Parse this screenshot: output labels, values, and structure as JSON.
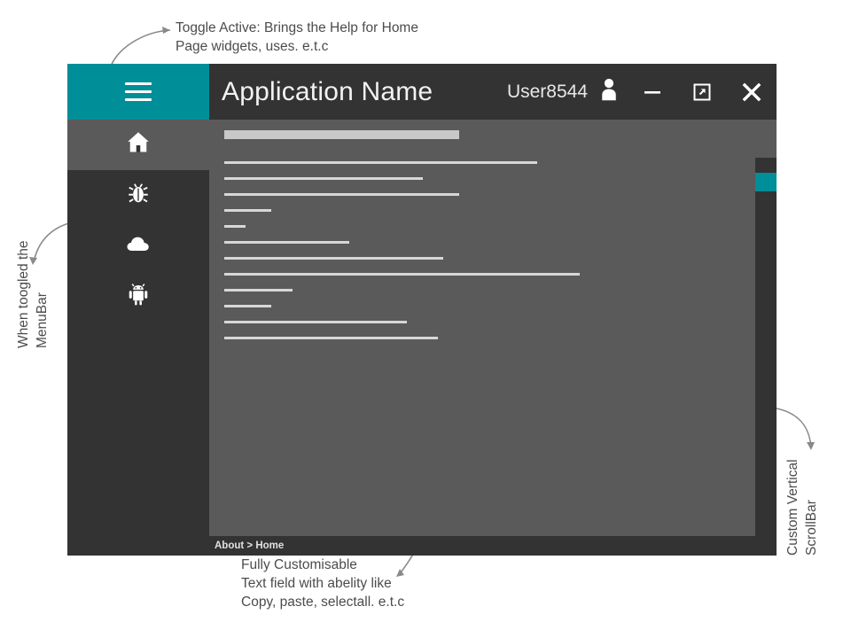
{
  "window": {
    "title": "Application Name",
    "user": "User8544",
    "menu_toggle_icon": "hamburger-icon",
    "user_icon": "person-icon",
    "minimize_label": "minimize-icon",
    "maximize_label": "restore-icon",
    "close_label": "close-icon"
  },
  "sidebar": {
    "items": [
      {
        "icon": "home-icon",
        "name": "home",
        "active": true
      },
      {
        "icon": "bug-icon",
        "name": "bug",
        "active": false
      },
      {
        "icon": "cloud-icon",
        "name": "cloud",
        "active": false
      },
      {
        "icon": "android-icon",
        "name": "android",
        "active": false
      }
    ]
  },
  "content": {
    "placeholder_bar_width_pct": 45,
    "skeleton_line_widths_pct": [
      60,
      38,
      45,
      9,
      4,
      24,
      42,
      68,
      13,
      9,
      35,
      41
    ]
  },
  "scrollbar": {
    "thumb_position_pct": 4,
    "thumb_size_pct": 5
  },
  "status": {
    "breadcrumb": "About > Home"
  },
  "annotations": {
    "toggle": "Toggle Active: Brings the Help for Home\nPage widgets, uses. e.t.c",
    "menubar": "When toogled the\nMenuBar",
    "scrollbar": "Custom Vertical\nScrollBar",
    "textfield": "Fully Customisable\nText field with abelity like\nCopy, paste, selectall. e.t.c"
  },
  "colors": {
    "accent": "#008e99",
    "titlebar": "#333333",
    "content": "#5a5a5a",
    "annotation_text": "#4c4c4c"
  }
}
